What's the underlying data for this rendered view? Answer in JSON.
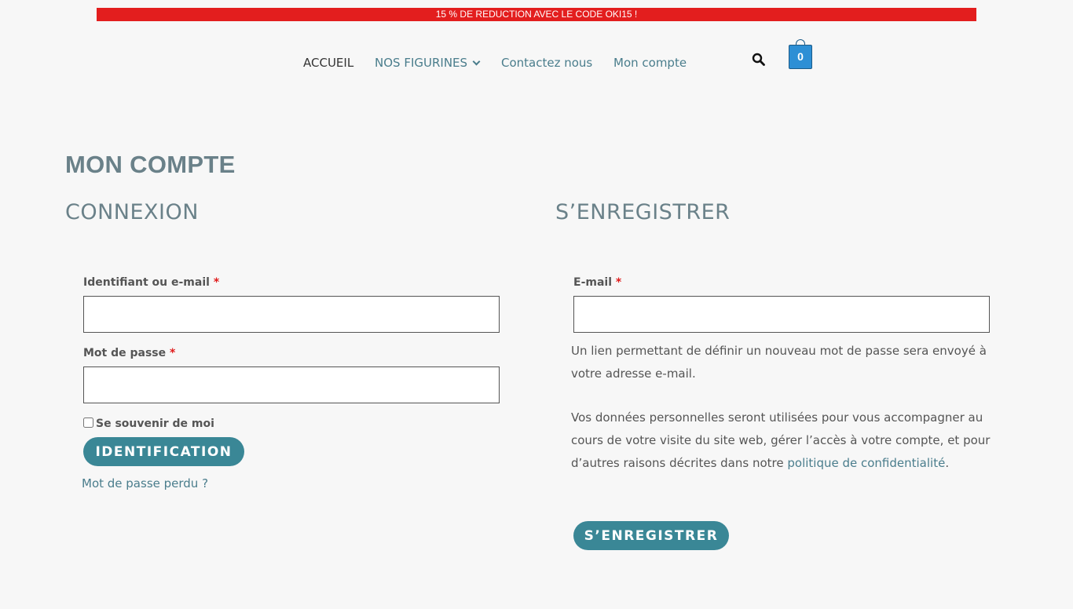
{
  "promo": {
    "text": "15 % DE REDUCTION AVEC LE CODE OKI15 !",
    "color": "#e31e1e"
  },
  "nav": {
    "items": [
      {
        "label": "ACCUEIL",
        "active": true
      },
      {
        "label": "NOS FIGURINES",
        "has_dropdown": true
      },
      {
        "label": "Contactez nous"
      },
      {
        "label": "Mon compte"
      }
    ],
    "search_icon": "search-icon",
    "cart": {
      "icon": "shopping-bag-icon",
      "count": "0",
      "color": "#2d8fd5"
    }
  },
  "page": {
    "title": "MON COMPTE"
  },
  "login": {
    "heading": "CONNEXION",
    "username_label": "Identifiant ou e-mail",
    "username_value": "",
    "password_label": "Mot de passe",
    "password_value": "",
    "required_mark": "*",
    "remember_label": "Se souvenir de moi",
    "submit_label": "IDENTIFICATION",
    "lost_password": "Mot de passe perdu ?"
  },
  "register": {
    "heading": "S’ENREGISTRER",
    "email_label": "E-mail",
    "email_value": "",
    "required_mark": "*",
    "password_info": "Un lien permettant de définir un nouveau mot de passe sera envoyé à votre adresse e-mail.",
    "privacy_text": "Vos données personnelles seront utilisées pour vous accompagner au cours de votre visite du site web, gérer l’accès à votre compte, et pour d’autres raisons décrites dans notre",
    "privacy_link": "politique de confidentialité",
    "privacy_end": ".",
    "submit_label": "S’ENREGISTRER"
  },
  "colors": {
    "accent": "#3a8796",
    "link": "#4a7d8c",
    "heading": "#6a8189",
    "required": "#e01b1b"
  }
}
